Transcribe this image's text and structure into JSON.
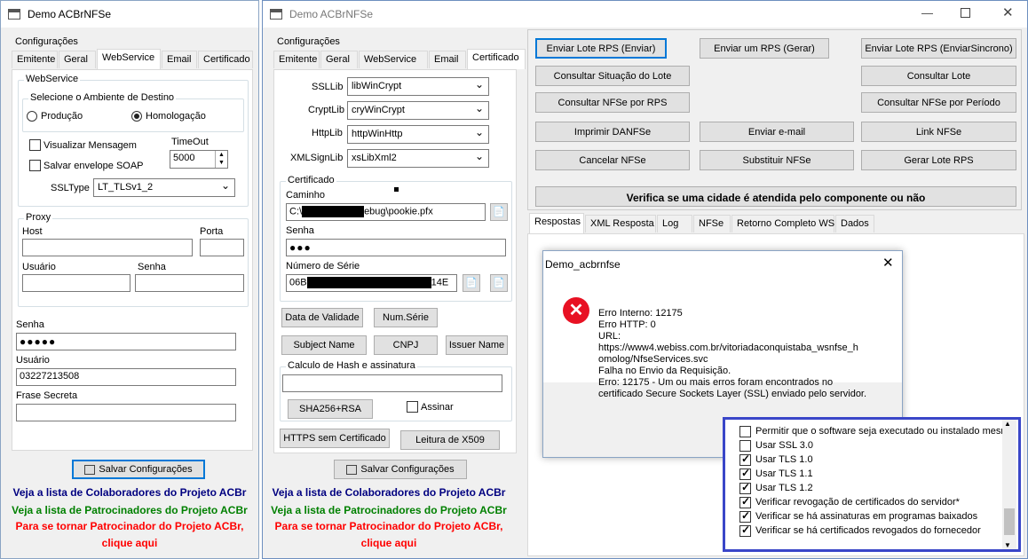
{
  "win1": {
    "title": "Demo ACBrNFSe",
    "config_label": "Configurações",
    "tabs": [
      "Emitente",
      "Geral",
      "WebService",
      "Email",
      "Certificado"
    ],
    "webservice_group": "WebService",
    "ambiente_group": "Selecione o Ambiente de Destino",
    "radio_producao": "Produção",
    "radio_homologacao": "Homologação",
    "chk_visualizar": "Visualizar Mensagem",
    "chk_salvar_soap": "Salvar envelope SOAP",
    "timeout_label": "TimeOut",
    "timeout_value": "5000",
    "ssltype_label": "SSLType",
    "ssltype_value": "LT_TLSv1_2",
    "proxy_group": "Proxy",
    "host_label": "Host",
    "porta_label": "Porta",
    "usuario_label": "Usuário",
    "senha_label": "Senha",
    "senha2_label": "Senha",
    "senha2_value": "●●●●●",
    "usuario2_label": "Usuário",
    "usuario2_value": "03227213508",
    "frase_label": "Frase Secreta",
    "salvar_btn": "Salvar Configurações",
    "link1": "Veja a lista de Colaboradores do Projeto ACBr",
    "link2": "Veja a lista de Patrocinadores do Projeto ACBr",
    "link3a": "Para se tornar Patrocinador do Projeto ACBr,",
    "link3b": "clique aqui"
  },
  "win2": {
    "title": "Demo ACBrNFSe",
    "config_label": "Configurações",
    "tabs": [
      "Emitente",
      "Geral",
      "WebService",
      "Email",
      "Certificado"
    ],
    "ssllib_label": "SSLLib",
    "ssllib_value": "libWinCrypt",
    "cryptlib_label": "CryptLib",
    "cryptlib_value": "cryWinCrypt",
    "httplib_label": "HttpLib",
    "httplib_value": "httpWinHttp",
    "xmlsign_label": "XMLSignLib",
    "xmlsign_value": "xsLibXml2",
    "cert_group": "Certificado",
    "caminho_label": "Caminho",
    "caminho_prefix": "C:\\",
    "caminho_suffix": "ebug\\pookie.pfx",
    "senha_label": "Senha",
    "senha_value": "●●●",
    "serie_label": "Número de Série",
    "serie_prefix": "06B",
    "serie_suffix": "14E",
    "btn_validade": "Data de Validade",
    "btn_numserie": "Num.Série",
    "btn_subject": "Subject Name",
    "btn_cnpj": "CNPJ",
    "btn_issuer": "Issuer Name",
    "hash_group": "Calculo de Hash e assinatura",
    "btn_sha": "SHA256+RSA",
    "chk_assinar": "Assinar",
    "btn_https": "HTTPS sem Certificado",
    "btn_x509": "Leitura de X509",
    "salvar_btn": "Salvar Configurações",
    "link1": "Veja a lista de Colaboradores do Projeto ACBr",
    "link2": "Veja a lista de Patrocinadores do Projeto ACBr",
    "link3a": "Para se tornar Patrocinador do Projeto ACBr,",
    "link3b": "clique aqui"
  },
  "actions": {
    "enviar_lote": "Enviar Lote RPS (Enviar)",
    "enviar_rps": "Enviar um RPS (Gerar)",
    "enviar_sinc": "Enviar Lote RPS (EnviarSincrono)",
    "consultar_situacao": "Consultar Situação do Lote",
    "consultar_lote": "Consultar Lote",
    "consultar_nfse_rps": "Consultar NFSe por RPS",
    "consultar_periodo": "Consultar NFSe por Período",
    "imprimir": "Imprimir DANFSe",
    "enviar_email": "Enviar e-mail",
    "link_nfse": "Link NFSe",
    "cancelar": "Cancelar NFSe",
    "substituir": "Substituir NFSe",
    "gerar_lote": "Gerar Lote RPS",
    "verifica_cidade": "Verifica se uma cidade é atendida pelo componente ou não"
  },
  "result_tabs": [
    "Respostas",
    "XML Resposta",
    "Log",
    "NFSe",
    "Retorno Completo WS",
    "Dados"
  ],
  "dialog": {
    "title": "Demo_acbrnfse",
    "lines": [
      "Erro Interno: 12175",
      "Erro HTTP: 0",
      "URL:",
      "https://www4.webiss.com.br/vitoriadaconquistaba_wsnfse_h",
      "omolog/NfseServices.svc",
      "Falha no Envio da Requisição.",
      "Erro: 12175 - Um ou mais erros foram encontrados no",
      "certificado Secure Sockets Layer (SSL) enviado pelo servidor."
    ]
  },
  "overlay": {
    "items": [
      {
        "label": "Permitir que o software seja executado ou instalado mesm",
        "checked": false
      },
      {
        "label": "Usar SSL 3.0",
        "checked": false
      },
      {
        "label": "Usar TLS 1.0",
        "checked": true
      },
      {
        "label": "Usar TLS 1.1",
        "checked": true
      },
      {
        "label": "Usar TLS 1.2",
        "checked": true
      },
      {
        "label": "Verificar revogação de certificados do servidor*",
        "checked": true
      },
      {
        "label": "Verificar se há assinaturas em programas baixados",
        "checked": true
      },
      {
        "label": "Verificar se há certificados revogados do fornecedor",
        "checked": true
      }
    ],
    "border_color": "#3a46c8"
  },
  "colors": {
    "link_blue": "#000080",
    "link_green": "#008000",
    "link_red": "#ff0000",
    "error_red": "#e81123"
  }
}
